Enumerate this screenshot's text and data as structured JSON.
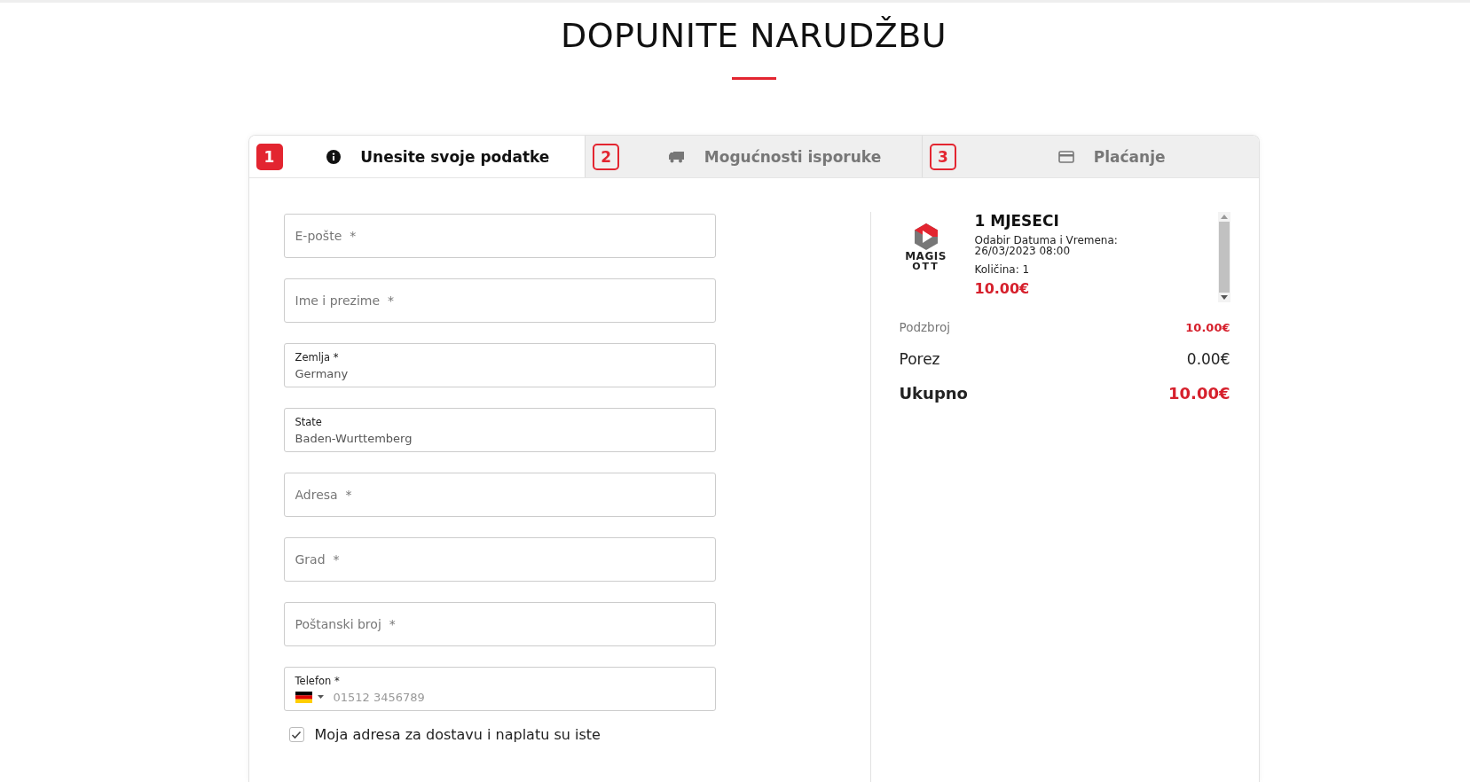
{
  "page": {
    "title": "DOPUNITE NARUDŽBU"
  },
  "tabs": [
    {
      "number": "1",
      "label": "Unesite svoje podatke",
      "kind": "info",
      "selected": true
    },
    {
      "number": "2",
      "label": "Mogućnosti isporuke",
      "kind": "truck",
      "selected": false
    },
    {
      "number": "3",
      "label": "Plaćanje",
      "kind": "card",
      "selected": false
    }
  ],
  "form": {
    "fields": [
      {
        "kind": "text",
        "placeholder": "E-pošte  *"
      },
      {
        "kind": "text",
        "placeholder": "Ime i prezime  *"
      },
      {
        "kind": "select",
        "label": "Zemlja  *",
        "value": "Germany"
      },
      {
        "kind": "select",
        "label": "State",
        "value": "Baden-Wurttemberg"
      },
      {
        "kind": "text",
        "placeholder": "Adresa  *"
      },
      {
        "kind": "text",
        "placeholder": "Grad  *"
      },
      {
        "kind": "text",
        "placeholder": "Poštanski broj  *"
      },
      {
        "kind": "phone",
        "label": "Telefon  *",
        "placeholder": "01512 3456789"
      }
    ],
    "same_address": {
      "label": "Moja adresa za dostavu i naplatu su iste",
      "checked": true
    }
  },
  "summary": {
    "item": {
      "logo_text": [
        "MAGIS",
        "OTT"
      ],
      "name": "1 MJESECI",
      "date": "Odabir Datuma i Vremena: 26/03/2023 08:00",
      "quantity": "Količina: 1",
      "price": "10.00€"
    },
    "subtotal": {
      "label": "Podzbroj",
      "value": "10.00€"
    },
    "tax": {
      "label": "Porez",
      "value": "0.00€"
    },
    "total": {
      "label": "Ukupno",
      "value": "10.00€"
    }
  }
}
